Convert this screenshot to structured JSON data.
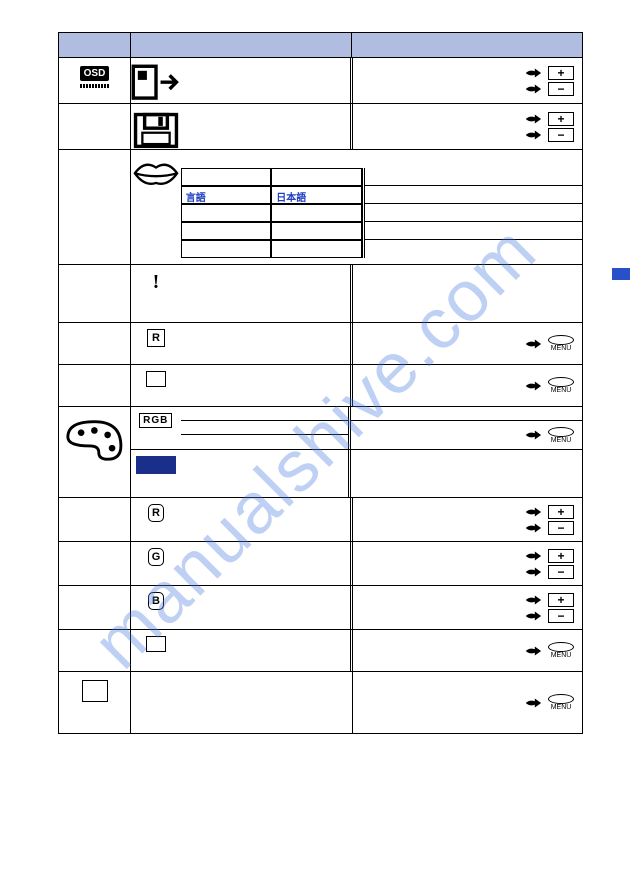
{
  "watermark": "manualshive.com",
  "header": {
    "c1": "",
    "c2": "",
    "c3": ""
  },
  "sections": {
    "osd": {
      "badge": "OSD",
      "rows": {
        "position": {},
        "save": {},
        "language": {
          "cells": {
            "lang_label": "言語",
            "jp": "日本語"
          }
        },
        "info": {},
        "recall": {
          "letter": "R"
        },
        "exit": {}
      }
    },
    "color": {
      "rows": {
        "rgb": {
          "label": "RGB"
        },
        "custom": {},
        "r": {
          "letter": "R"
        },
        "g": {
          "letter": "G"
        },
        "b": {
          "letter": "B"
        },
        "exit": {}
      }
    },
    "exit": {}
  },
  "controls": {
    "plus": "+",
    "minus": "−",
    "menu": "MENU"
  }
}
